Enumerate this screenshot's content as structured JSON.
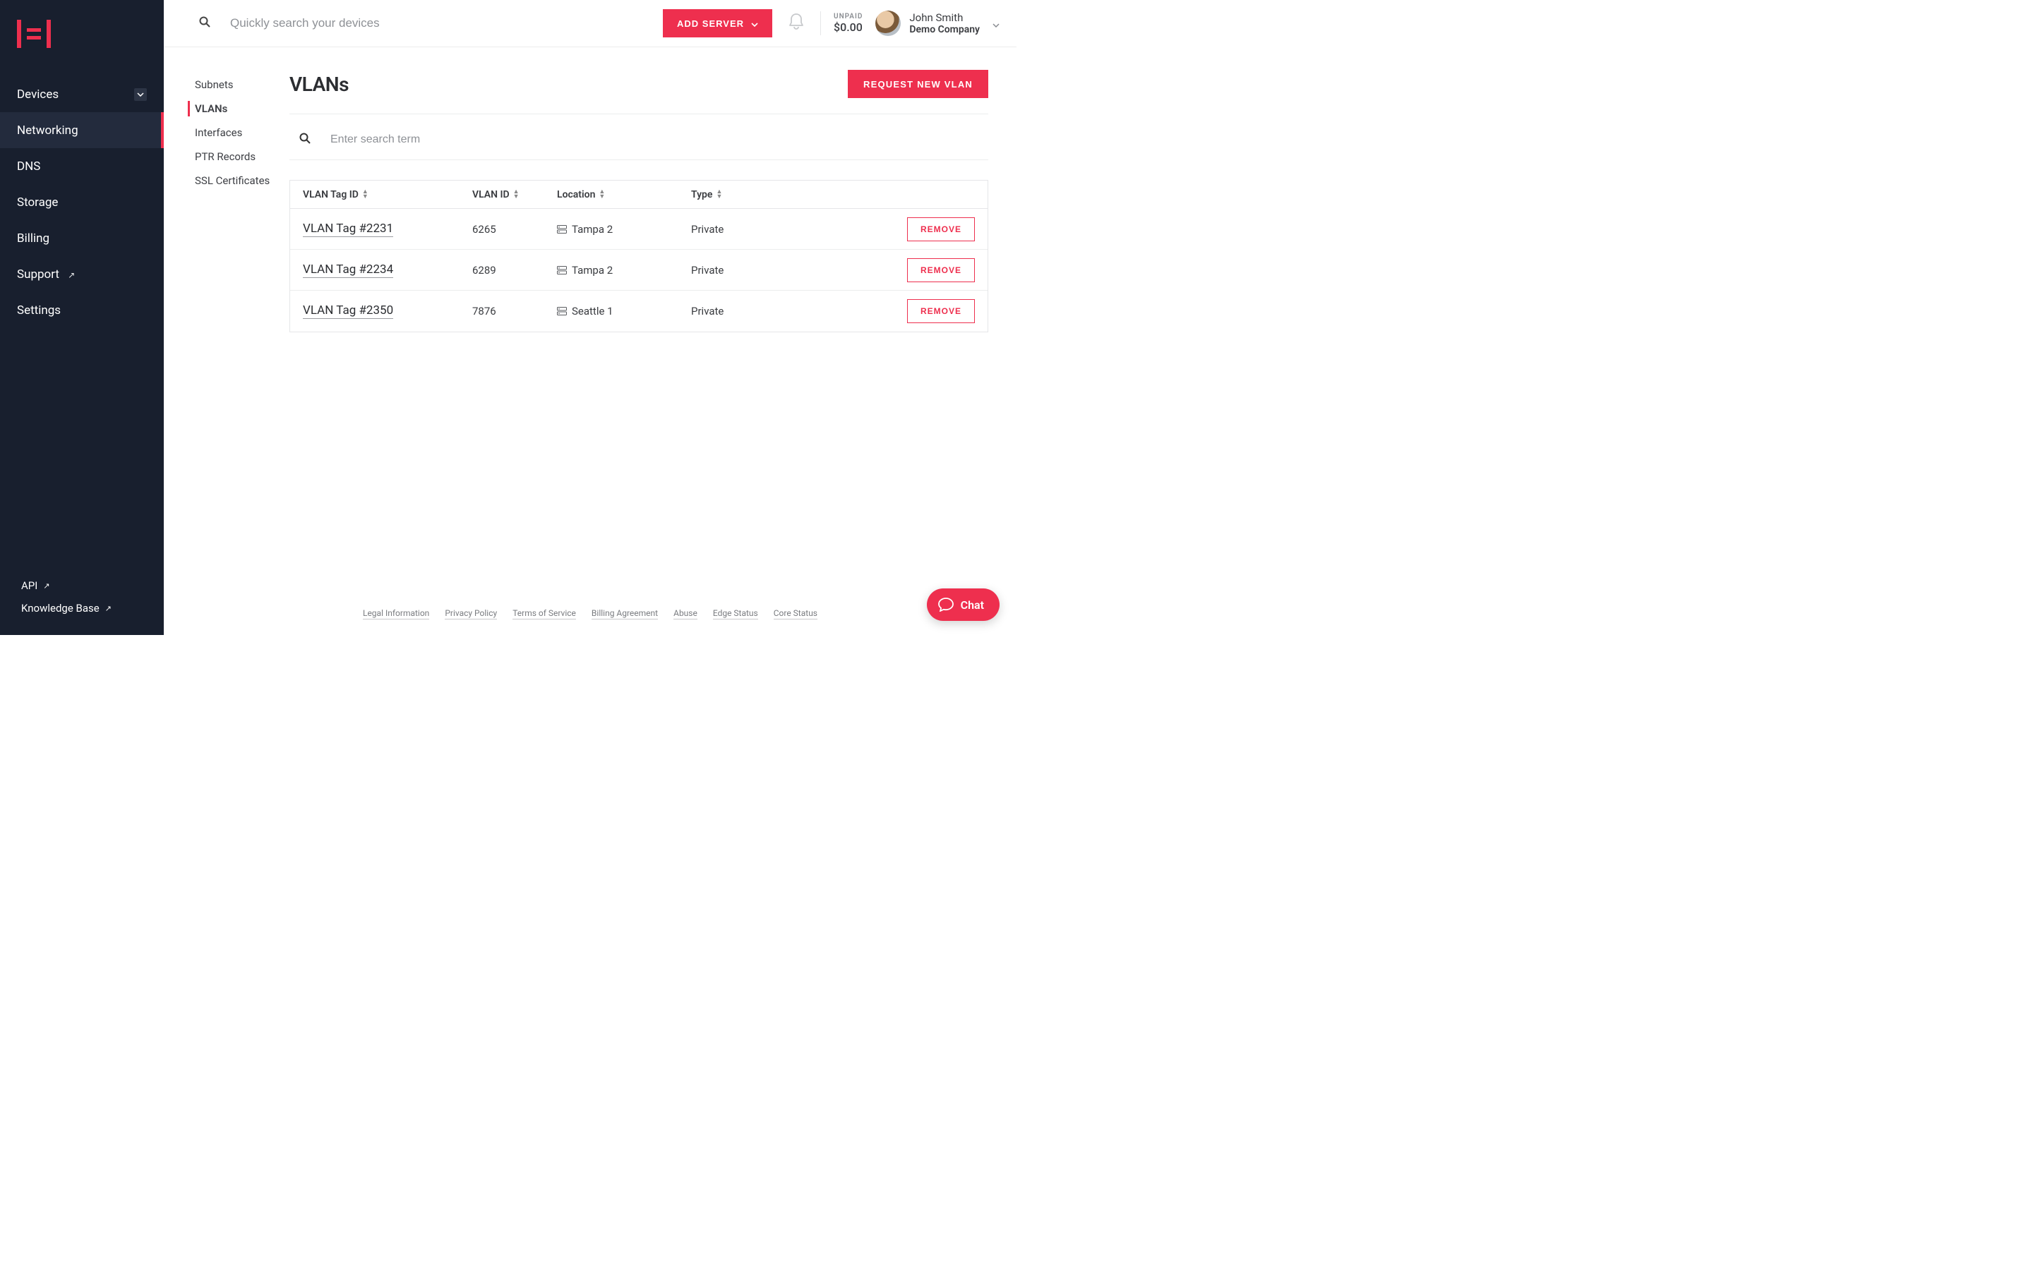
{
  "header": {
    "search_placeholder": "Quickly search your devices",
    "add_server_label": "ADD SERVER",
    "unpaid_label": "UNPAID",
    "unpaid_amount": "$0.00",
    "user_name": "John Smith",
    "user_company": "Demo Company"
  },
  "sidebar": {
    "items": [
      {
        "label": "Devices",
        "has_chevron": true
      },
      {
        "label": "Networking",
        "active": true
      },
      {
        "label": "DNS"
      },
      {
        "label": "Storage"
      },
      {
        "label": "Billing"
      },
      {
        "label": "Support",
        "external": true
      },
      {
        "label": "Settings"
      }
    ],
    "bottom": [
      {
        "label": "API",
        "external": true
      },
      {
        "label": "Knowledge Base",
        "external": true
      }
    ]
  },
  "subnav": {
    "items": [
      {
        "label": "Subnets"
      },
      {
        "label": "VLANs",
        "active": true
      },
      {
        "label": "Interfaces"
      },
      {
        "label": "PTR Records"
      },
      {
        "label": "SSL Certificates"
      }
    ]
  },
  "page": {
    "title": "VLANs",
    "request_button": "REQUEST NEW VLAN",
    "filter_placeholder": "Enter search term"
  },
  "table": {
    "headers": [
      "VLAN Tag ID",
      "VLAN ID",
      "Location",
      "Type"
    ],
    "remove_label": "REMOVE",
    "rows": [
      {
        "tag": "VLAN Tag #2231",
        "vlan_id": "6265",
        "location": "Tampa 2",
        "type": "Private"
      },
      {
        "tag": "VLAN Tag #2234",
        "vlan_id": "6289",
        "location": "Tampa 2",
        "type": "Private"
      },
      {
        "tag": "VLAN Tag #2350",
        "vlan_id": "7876",
        "location": "Seattle 1",
        "type": "Private"
      }
    ]
  },
  "footer": {
    "links": [
      "Legal Information",
      "Privacy Policy",
      "Terms of Service",
      "Billing Agreement",
      "Abuse",
      "Edge Status",
      "Core Status"
    ]
  },
  "chat": {
    "label": "Chat"
  }
}
